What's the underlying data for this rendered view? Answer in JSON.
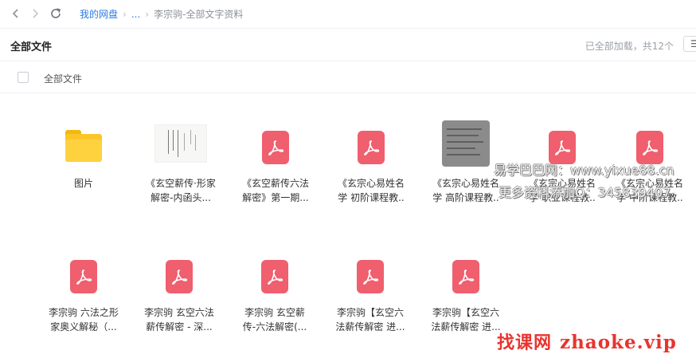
{
  "breadcrumb": {
    "root": "我的网盘",
    "ellipsis": "...",
    "current": "李宗驹-全部文字资料"
  },
  "toolbar": {
    "title": "全部文件",
    "load_status": "已全部加载，共12个",
    "view_toggle": "☰"
  },
  "list_header": {
    "label": "全部文件"
  },
  "files": [
    {
      "name_line1": "图片",
      "name_line2": "",
      "icon": "folder-icon"
    },
    {
      "name_line1": "《玄空薪传·形家",
      "name_line2": "解密-内函头...",
      "icon": "document-thumbnail"
    },
    {
      "name_line1": "《玄空薪传六法",
      "name_line2": "解密》第一期...",
      "icon": "pdf-icon"
    },
    {
      "name_line1": "《玄宗心易姓名",
      "name_line2": "学 初阶课程教..",
      "icon": "pdf-icon"
    },
    {
      "name_line1": "《玄宗心易姓名",
      "name_line2": "学 高阶课程教..",
      "icon": "scanned-page-thumbnail"
    },
    {
      "name_line1": "《玄宗心易姓名",
      "name_line2": "学 职业课程教..",
      "icon": "pdf-icon"
    },
    {
      "name_line1": "《玄宗心易姓名",
      "name_line2": "学 中阶课程教..",
      "icon": "pdf-icon"
    },
    {
      "name_line1": "李宗驹 六法之形",
      "name_line2": "家奥义解秘（...",
      "icon": "pdf-icon"
    },
    {
      "name_line1": "李宗驹 玄空六法",
      "name_line2": "薪传解密 - 深...",
      "icon": "pdf-icon"
    },
    {
      "name_line1": "李宗驹 玄空薪",
      "name_line2": "传-六法解密(...",
      "icon": "pdf-icon"
    },
    {
      "name_line1": "李宗驹【玄空六",
      "name_line2": "法薪传解密 进...",
      "icon": "pdf-icon"
    },
    {
      "name_line1": "李宗驹【玄空六",
      "name_line2": "法薪传解密 进...",
      "icon": "pdf-icon"
    }
  ],
  "watermarks": {
    "line1": "易学巴巴网：www.yixue88.cn",
    "line2": "更多资料添加Q：345839407",
    "brand_cn": "找课网",
    "brand_en": "zhaoke.vip"
  },
  "colors": {
    "link": "#2a7be0",
    "pdf": "#ef5f6e",
    "folder": "#fcc62a",
    "watermark_red": "#e8342f"
  }
}
